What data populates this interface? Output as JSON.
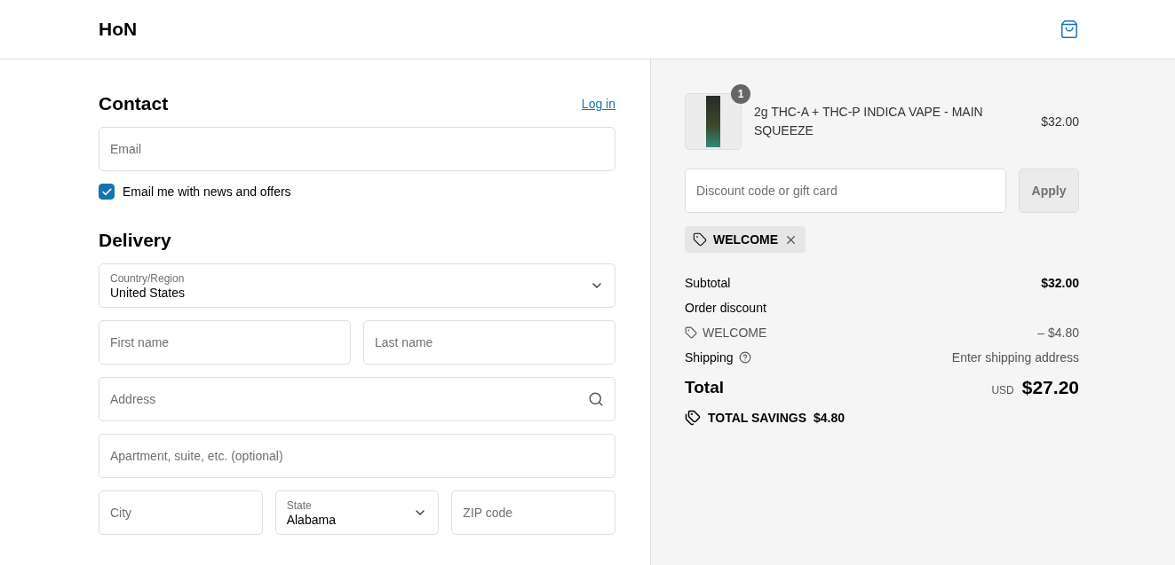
{
  "header": {
    "logo": "HoN"
  },
  "contact": {
    "title": "Contact",
    "login_link": "Log in",
    "email": {
      "placeholder": "Email"
    },
    "newsletter": {
      "label": "Email me with news and offers",
      "checked": true
    }
  },
  "delivery": {
    "title": "Delivery",
    "rows": [
      {
        "fields": [
          {
            "kind": "select",
            "label": "Country/Region",
            "value": "United States"
          }
        ]
      },
      {
        "fields": [
          {
            "kind": "text",
            "placeholder": "First name"
          },
          {
            "kind": "text",
            "placeholder": "Last name"
          }
        ]
      },
      {
        "fields": [
          {
            "kind": "search",
            "placeholder": "Address"
          }
        ]
      },
      {
        "fields": [
          {
            "kind": "text",
            "placeholder": "Apartment, suite, etc. (optional)"
          }
        ]
      },
      {
        "fields": [
          {
            "kind": "text",
            "placeholder": "City"
          },
          {
            "kind": "select",
            "label": "State",
            "value": "Alabama"
          },
          {
            "kind": "text",
            "placeholder": "ZIP code"
          }
        ]
      }
    ]
  },
  "summary": {
    "items": [
      {
        "name": "2g THC-A + THC-P INDICA VAPE - MAIN SQUEEZE",
        "quantity": "1",
        "price": "$32.00"
      }
    ],
    "discount": {
      "placeholder": "Discount code or gift card",
      "button": "Apply"
    },
    "applied_codes": [
      {
        "code": "WELCOME"
      }
    ],
    "lines": [
      {
        "kind": "subtotal",
        "label": "Subtotal",
        "value": "$32.00"
      },
      {
        "kind": "plain",
        "label": "Order discount"
      },
      {
        "kind": "code",
        "label": "WELCOME",
        "value": "– $4.80"
      },
      {
        "kind": "help",
        "label": "Shipping",
        "value": "Enter shipping address"
      }
    ],
    "total": {
      "label": "Total",
      "currency": "USD",
      "amount": "$27.20"
    },
    "savings": {
      "label": "TOTAL SAVINGS",
      "amount": "$4.80"
    }
  }
}
